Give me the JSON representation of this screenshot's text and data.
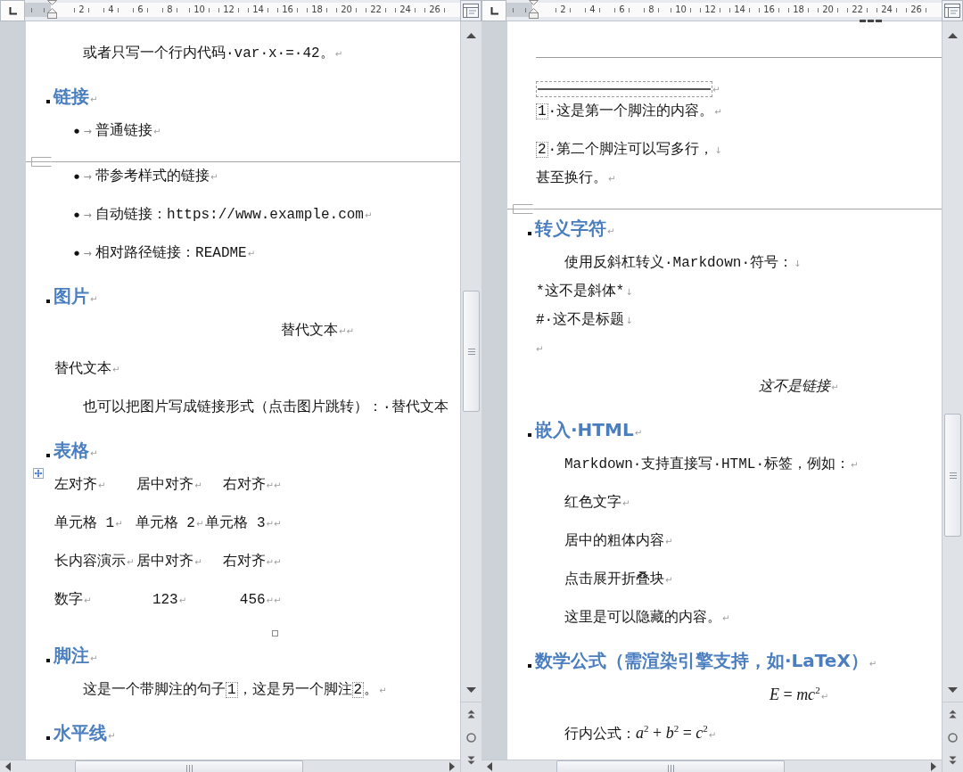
{
  "panes": [
    {
      "ruler": {
        "numbers": [
          "2",
          "4",
          "6",
          "8",
          "10",
          "12",
          "14",
          "16",
          "18",
          "20",
          "22",
          "24",
          "26"
        ]
      },
      "blocks": [
        {
          "kind": "body",
          "text": "或者只写一个行内代码·var·x·=·42。",
          "mark": "↵"
        },
        {
          "kind": "heading",
          "text": "链接",
          "mark": "↵"
        },
        {
          "kind": "bullet",
          "bullet": "●",
          "tab": "→",
          "text": "普通链接",
          "mark": "↵"
        },
        {
          "kind": "page_break"
        },
        {
          "kind": "bullet",
          "bullet": "●",
          "tab": "→",
          "text": "带参考样式的链接",
          "mark": "↵"
        },
        {
          "kind": "bullet",
          "bullet": "●",
          "tab": "→",
          "text": "自动链接：https://www.example.com",
          "mark": "↵"
        },
        {
          "kind": "bullet",
          "bullet": "●",
          "tab": "→",
          "text": "相对路径链接：README",
          "mark": "↵"
        },
        {
          "kind": "heading",
          "text": "图片",
          "mark": "↵"
        },
        {
          "kind": "caption",
          "text": "替代文本",
          "mark": "↵↵"
        },
        {
          "kind": "plain",
          "text": "替代文本",
          "mark": "↵"
        },
        {
          "kind": "body",
          "text": "也可以把图片写成链接形式（点击图片跳转）：·替代文本"
        },
        {
          "kind": "heading",
          "text": "表格",
          "mark": "↵"
        },
        {
          "kind": "table",
          "columns": [
            {
              "label": "左对齐",
              "kind": "left"
            },
            {
              "label": "居中对齐",
              "kind": "center"
            },
            {
              "label": "右对齐",
              "kind": "right"
            }
          ],
          "rows": [
            [
              "单元格 1",
              "单元格 2",
              "单元格 3"
            ],
            [
              "长内容演示",
              "居中对齐",
              "右对齐"
            ],
            [
              "数字",
              "123",
              "456"
            ]
          ],
          "cell_mark": "↵",
          "row_mark": "↵"
        },
        {
          "kind": "heading",
          "text": "脚注",
          "mark": "↵"
        },
        {
          "kind": "body",
          "parts": [
            {
              "text": "这是一个带脚注的句子"
            },
            {
              "ref": "1"
            },
            {
              "text": "，这是另一个脚注"
            },
            {
              "ref": "2"
            },
            {
              "text": "。"
            }
          ],
          "mark": "↵"
        },
        {
          "kind": "heading",
          "text": "水平线",
          "mark": "↵"
        }
      ]
    },
    {
      "ruler": {
        "numbers": [
          "2",
          "4",
          "6",
          "8",
          "10",
          "12",
          "14",
          "16",
          "18",
          "20",
          "22",
          "24",
          "26"
        ],
        "dashed_marker": true
      },
      "blocks": [
        {
          "kind": "rule"
        },
        {
          "kind": "footnote_separator",
          "mark": "↵"
        },
        {
          "kind": "plain",
          "number": "1",
          "text": "·这是第一个脚注的内容。",
          "mark": "↵"
        },
        {
          "kind": "plain",
          "lines": [
            {
              "number": "2",
              "text": "·第二个脚注可以写多行，",
              "mark": "↓"
            },
            {
              "text": "甚至换行。",
              "mark": "↵"
            }
          ]
        },
        {
          "kind": "page_break"
        },
        {
          "kind": "heading",
          "text": "转义字符",
          "mark": "↵"
        },
        {
          "kind": "body",
          "lines": [
            {
              "text": "使用反斜杠转义·Markdown·符号：",
              "mark": "↓"
            },
            {
              "text": "*这不是斜体*",
              "mark": "↓"
            },
            {
              "text": "#·这不是标题",
              "mark": "↓"
            },
            {
              "mark": "↵"
            }
          ]
        },
        {
          "kind": "emphasis",
          "text": "这不是链接",
          "mark": "↵"
        },
        {
          "kind": "heading",
          "text": "嵌入·HTML",
          "mark": "↵"
        },
        {
          "kind": "body",
          "text": "Markdown·支持直接写·HTML·标签，例如：",
          "mark": "↵"
        },
        {
          "kind": "body",
          "text": "红色文字",
          "mark": "↵"
        },
        {
          "kind": "body",
          "text": "居中的粗体内容",
          "mark": "↵"
        },
        {
          "kind": "body",
          "text": "点击展开折叠块",
          "mark": "↵"
        },
        {
          "kind": "body",
          "text": "这里是可以隐藏的内容。",
          "mark": "↵"
        },
        {
          "kind": "heading",
          "text": "数学公式（需渲染引擎支持，如·LaTeX）",
          "mark": "↵"
        },
        {
          "kind": "equation",
          "math": "*E* = *mc*$^{2}$",
          "mark": "↵"
        },
        {
          "kind": "body",
          "text": "行内公式：",
          "math": "*a*$^{2}$ + *b*$^{2}$ = *c*$^{2}$",
          "mark": "↵"
        }
      ]
    }
  ]
}
